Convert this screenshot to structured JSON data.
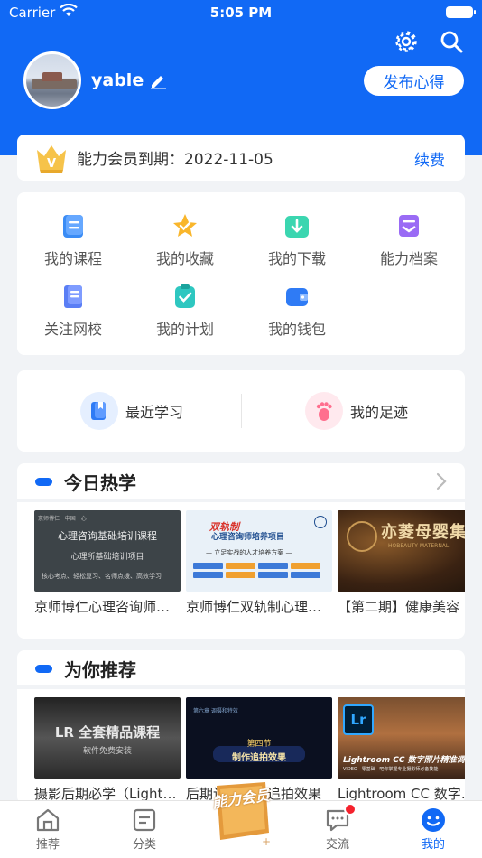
{
  "status_bar": {
    "carrier": "Carrier",
    "time": "5:05 PM"
  },
  "profile": {
    "username": "yable",
    "publish_label": "发布心得"
  },
  "membership": {
    "text": "能力会员到期：2022-11-05",
    "renew_label": "续费"
  },
  "menu": [
    {
      "label": "我的课程",
      "icon": "course-icon"
    },
    {
      "label": "我的收藏",
      "icon": "star-icon"
    },
    {
      "label": "我的下载",
      "icon": "download-icon"
    },
    {
      "label": "能力档案",
      "icon": "archive-icon"
    },
    {
      "label": "关注网校",
      "icon": "school-icon"
    },
    {
      "label": "我的计划",
      "icon": "plan-icon"
    },
    {
      "label": "我的钱包",
      "icon": "wallet-icon"
    }
  ],
  "quick": {
    "recent": "最近学习",
    "footprint": "我的足迹"
  },
  "hot": {
    "title": "今日热学",
    "items": [
      {
        "title": "京师博仁心理咨询师基础培训课程",
        "line1": "心理咨询基础培训课程",
        "line2": "心理所基础培训项目",
        "line3": "核心考点、轻松复习、名师点拨、高效学习",
        "tag": "京师博仁 · 中国一心"
      },
      {
        "title": "京师博仁双轨制心理咨询师培养项目",
        "red": "双轨制",
        "line1": "心理咨询师培养项目",
        "line2": "— 立足实战的人才培养方案 —"
      },
      {
        "title": "【第二期】健康美容",
        "big": "亦菱母婴集团",
        "sub": "HOBEAUTY MATERNAL"
      }
    ]
  },
  "recommend": {
    "title": "为你推荐",
    "items": [
      {
        "title": "摄影后期必学（Lightroom）",
        "line1": "LR 全套精品课程",
        "line2": "软件免费安装"
      },
      {
        "title": "后期调色制作追拍效果",
        "small": "第六章  调摄和特效",
        "c1": "第四节",
        "c2": "制作追拍效果"
      },
      {
        "title": "Lightroom CC 数字照片精准调色",
        "lr": "Lr",
        "t": "Lightroom CC 数字照片精准调",
        "s": "VIDEO · 零基础 · 吧你掌握专业摄影师必备技能"
      }
    ]
  },
  "tabbar": {
    "home": "推荐",
    "category": "分类",
    "vip": "能力会员",
    "community": "交流",
    "mine": "我的"
  },
  "colors": {
    "accent": "#1169f5",
    "badge": "#f5222d"
  }
}
